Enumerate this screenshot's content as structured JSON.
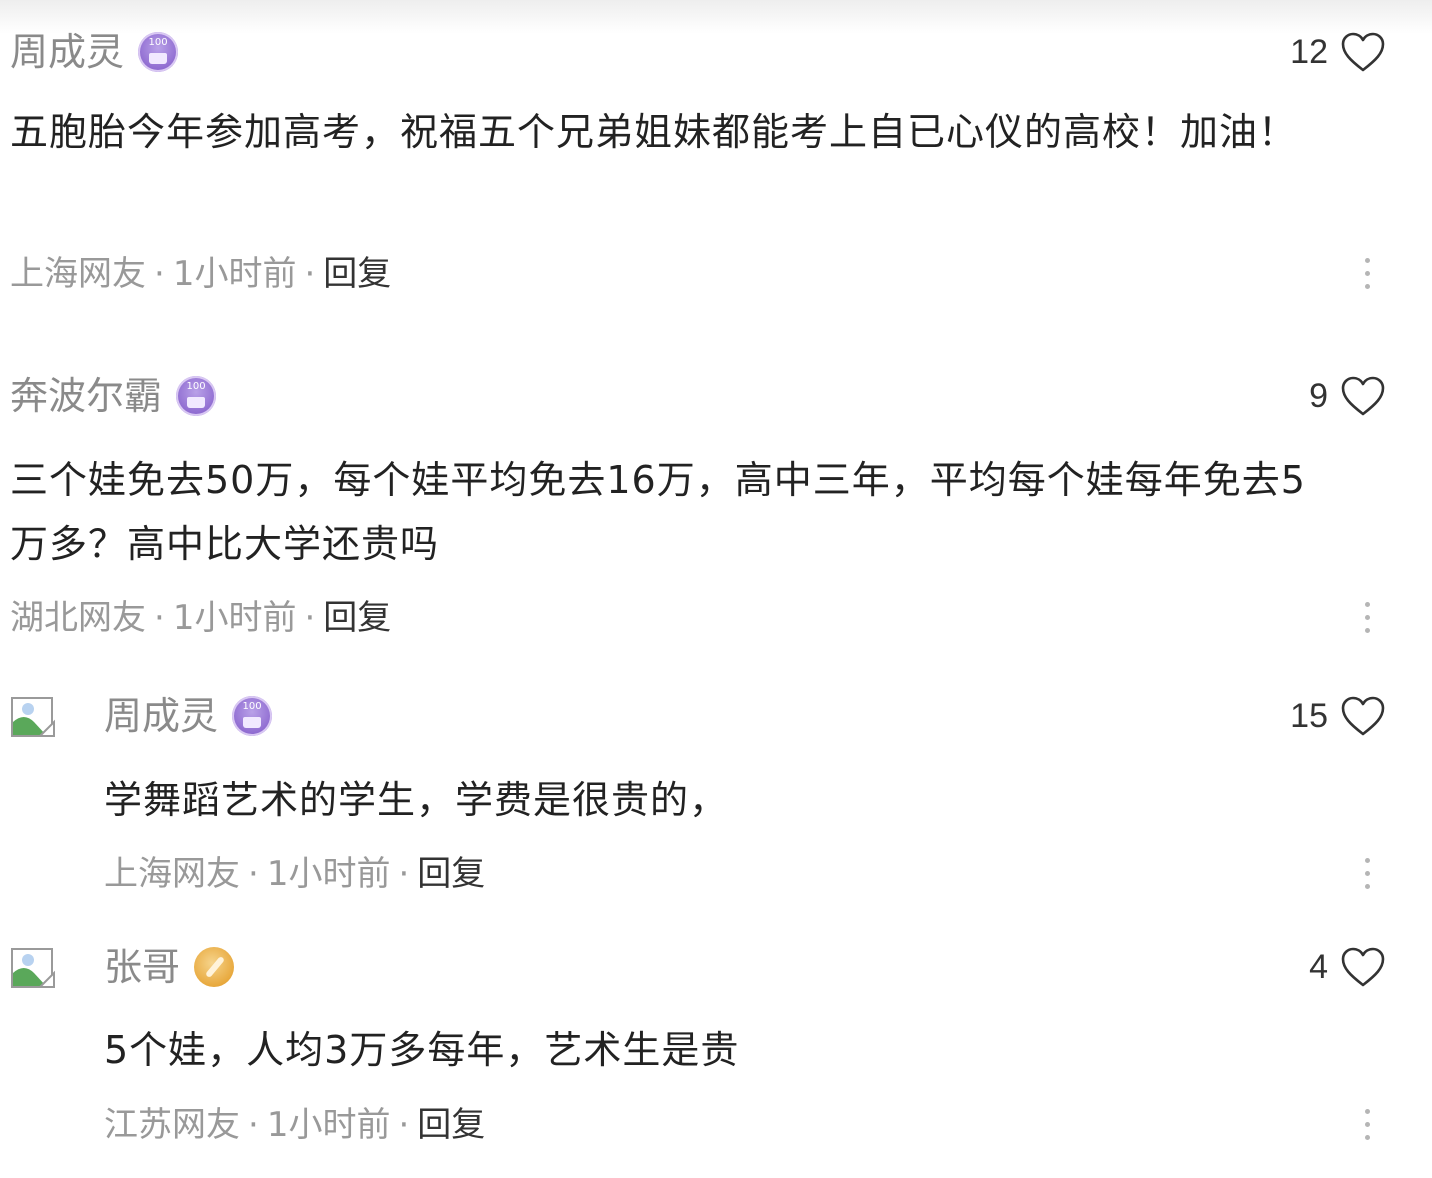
{
  "comments": [
    {
      "name": "周成灵",
      "badge_text": "100",
      "likes": "12",
      "text": "五胞胎今年参加高考，祝福五个兄弟姐妹都能考上自已心仪的高校！加油！",
      "location": "上海网友",
      "time": "1小时前",
      "reply_label": "回复"
    },
    {
      "name": "奔波尔霸",
      "badge_text": "100",
      "likes": "9",
      "text": "三个娃免去50万，每个娃平均免去16万，高中三年，平均每个娃每年免去5万多？高中比大学还贵吗",
      "location": "湖北网友",
      "time": "1小时前",
      "reply_label": "回复"
    },
    {
      "name": "周成灵",
      "badge_text": "100",
      "likes": "15",
      "text": "学舞蹈艺术的学生，学费是很贵的，",
      "location": "上海网友",
      "time": "1小时前",
      "reply_label": "回复"
    },
    {
      "name": "张哥",
      "likes": "4",
      "text": "5个娃，人均3万多每年，艺术生是贵",
      "location": "江苏网友",
      "time": "1小时前",
      "reply_label": "回复"
    }
  ],
  "separator": "·",
  "icons": {
    "like": "heart-outline-icon",
    "more": "more-vertical-icon",
    "avatar": "broken-image-avatar-icon"
  }
}
